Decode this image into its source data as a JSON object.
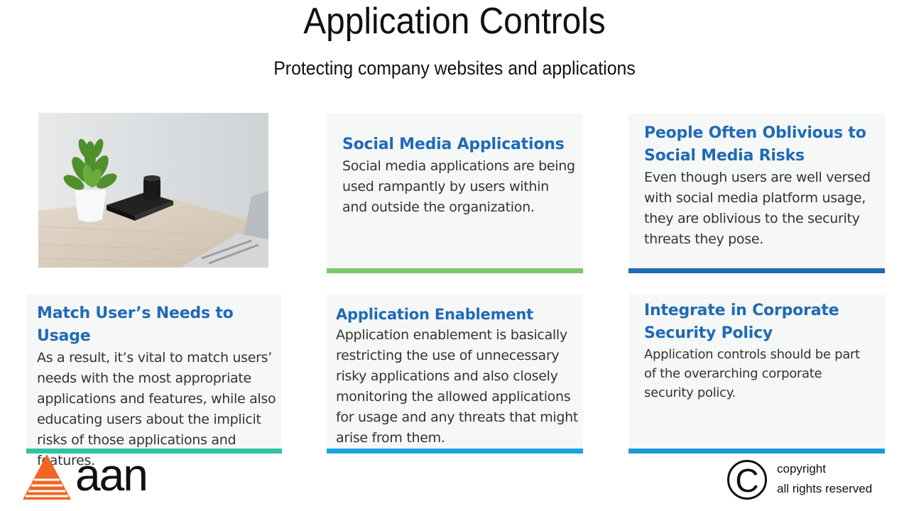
{
  "header": {
    "title": "Application Controls",
    "subtitle": "Protecting company websites and applications"
  },
  "cards": [
    {
      "heading": "Social Media Applications",
      "body": "Social media applications are being used rampantly by users within and outside the organization.",
      "accent": "#7ac86a"
    },
    {
      "heading": "People Often Oblivious to Social Media Risks",
      "body": "Even though users are well versed with social media platform usage, they are oblivious to the security threats they pose.",
      "accent": "#1f6bb5"
    },
    {
      "heading": "Match User’s Needs to Usage",
      "body": "As a result, it’s vital to match users’ needs with the most appropriate applications and features, while also educating users about the implicit risks of those applications and features.",
      "accent": "#2ec4a0"
    },
    {
      "heading": "Application  Enablement",
      "body": "Application enablement is basically restricting the use of unnecessary risky applications and also closely monitoring the allowed applications for usage and any threats that might arise from them.",
      "accent": "#1aa3e0"
    },
    {
      "heading": "Integrate in Corporate Security Policy",
      "body": "Application controls should be part of the overarching corporate security policy.",
      "accent": "#1a9bd8"
    }
  ],
  "logo": {
    "text": "aan",
    "icon": "triangle-logo-icon",
    "color": "#f26522"
  },
  "footer": {
    "copyright_symbol": "©",
    "line1": "copyright",
    "line2": "all rights reserved"
  },
  "photo": {
    "icon": "desk-plant-photo"
  }
}
